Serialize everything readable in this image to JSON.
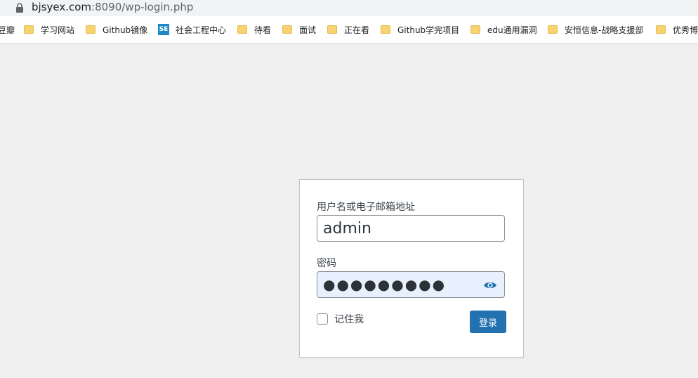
{
  "browser": {
    "url_host": "bjsyex.com",
    "url_rest": ":8090/wp-login.php",
    "bookmarks": [
      {
        "label": "豆瓣",
        "icon": "none"
      },
      {
        "label": "学习网站",
        "icon": "folder-icon"
      },
      {
        "label": "Github镜像",
        "icon": "folder-icon"
      },
      {
        "label": "社会工程中心",
        "icon": "se-icon"
      },
      {
        "label": "待看",
        "icon": "folder-icon"
      },
      {
        "label": "面试",
        "icon": "folder-icon"
      },
      {
        "label": "正在看",
        "icon": "folder-icon"
      },
      {
        "label": "Github学完项目",
        "icon": "folder-icon"
      },
      {
        "label": "edu通用漏洞",
        "icon": "folder-icon"
      },
      {
        "label": "安恒信息-战略支援部",
        "icon": "folder-icon"
      },
      {
        "label": "优秀博",
        "icon": "folder-icon"
      }
    ],
    "se_icon_text": "SE"
  },
  "login": {
    "username_label": "用户名或电子邮箱地址",
    "username_value": "admin",
    "password_label": "密码",
    "password_value": "●●●●●●●●●",
    "remember_label": "记住我",
    "submit_label": "登录"
  },
  "colors": {
    "primary": "#2271b1",
    "background": "#f0f0f1",
    "autofill": "#e8f0fe"
  }
}
